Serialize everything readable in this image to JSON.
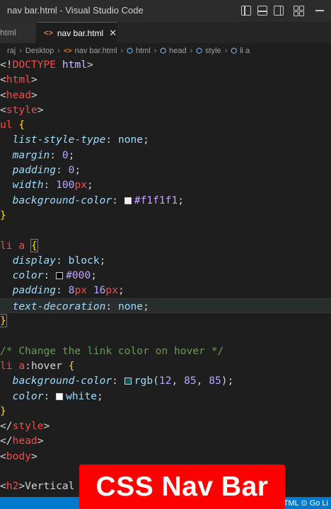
{
  "window": {
    "title": "nav bar.html - Visual Studio Code"
  },
  "tabs": [
    {
      "label": "html",
      "active": false
    },
    {
      "label": "nav bar.html",
      "active": true,
      "close": "✕"
    }
  ],
  "breadcrumb": [
    "raj",
    "Desktop",
    "nav bar.html",
    "html",
    "head",
    "style",
    "li a"
  ],
  "code": {
    "l1_a": "<!",
    "l1_b": "DOCTYPE",
    "l1_c": " html",
    "l1_d": ">",
    "l2": "html",
    "l3": "head",
    "l4": "style",
    "l5_sel": "ul",
    "l5_brace": "{",
    "l6_prop": "list-style-type",
    "l6_val": "none",
    "l7_prop": "margin",
    "l7_val": "0",
    "l8_prop": "padding",
    "l8_val": "0",
    "l9_prop": "width",
    "l9_num": "100",
    "l9_unit": "px",
    "l10_prop": "background-color",
    "l10_val": "#f1f1f1",
    "l11": "}",
    "l13_sel1": "li",
    "l13_sel2": "a",
    "l13_brace": "{",
    "l14_prop": "display",
    "l14_val": "block",
    "l15_prop": "color",
    "l15_val": "#000",
    "l16_prop": "padding",
    "l16_n1": "8",
    "l16_u1": "px",
    "l16_n2": "16",
    "l16_u2": "px",
    "l17_prop": "text-decoration",
    "l17_val": "none",
    "l18": "}",
    "l20_comment": "/* Change the link color on hover */",
    "l21_sel1": "li",
    "l21_sel2": "a",
    "l21_pseudo": ":hover",
    "l21_brace": "{",
    "l22_prop": "background-color",
    "l22_fn": "rgb",
    "l22_a": "12",
    "l22_b": "85",
    "l22_c": "85",
    "l23_prop": "color",
    "l23_val": "white",
    "l24": "}",
    "l25": "style",
    "l26": "head",
    "l27": "body",
    "l29_tag": "h2",
    "l29_text": "Vertical"
  },
  "swatches": {
    "f1f1f1": "#f1f1f1",
    "black": "#000000",
    "teal": "#0c5555",
    "white": "#ffffff"
  },
  "status": {
    "lang": "TML",
    "golive": "Go Li"
  },
  "banner": {
    "text": "CSS Nav Bar"
  }
}
